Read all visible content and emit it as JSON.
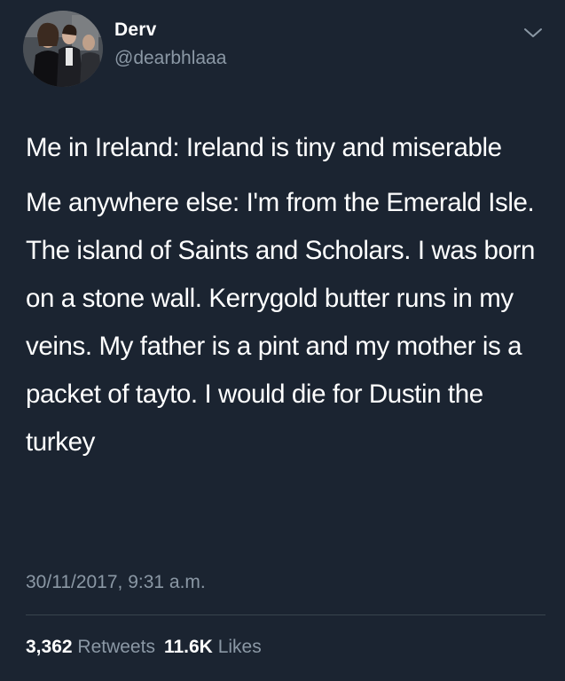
{
  "user": {
    "display_name": "Derv",
    "handle": "@dearbhlaaa",
    "avatar_icon": "profile-photo"
  },
  "tweet": {
    "paragraphs": [
      "Me in Ireland: Ireland is tiny and miserable",
      "Me anywhere else: I'm from the Emerald Isle. The island of Saints and Scholars. I was born on a stone wall. Kerrygold butter runs in my veins. My father is a pint and my mother is a packet of tayto. I would die for Dustin the turkey"
    ],
    "timestamp": "30/11/2017, 9:31 a.m."
  },
  "stats": {
    "retweets_count": "3,362",
    "retweets_label": "Retweets",
    "likes_count": "11.6K",
    "likes_label": "Likes"
  },
  "colors": {
    "background": "#1b2431",
    "primary_text": "#ffffff",
    "secondary_text": "#8b98a5",
    "divider": "#38444d"
  },
  "icons": {
    "menu": "chevron-down-icon"
  }
}
